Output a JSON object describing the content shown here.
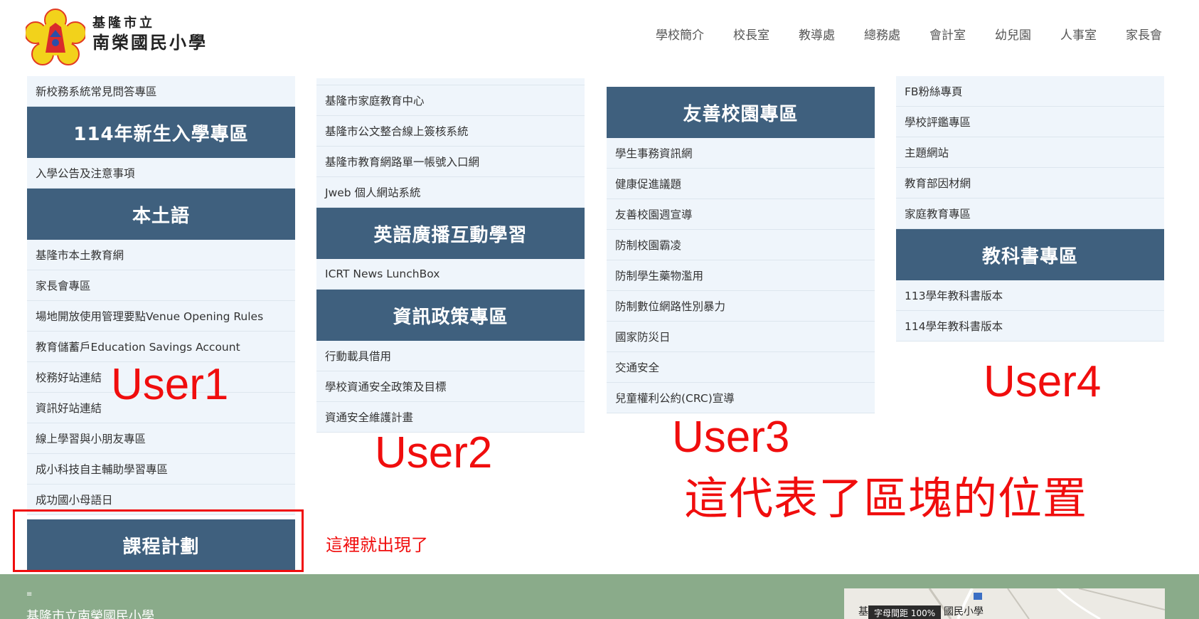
{
  "header": {
    "school_line1": "基隆市立",
    "school_line2": "南榮國民小學",
    "nav": [
      "學校簡介",
      "校長室",
      "教導處",
      "總務處",
      "會計室",
      "幼兒園",
      "人事室",
      "家長會"
    ]
  },
  "col1": {
    "top_link": "新校務系統常見問答專區",
    "sec1_title": "114年新生入學專區",
    "sec1_links": [
      "入學公告及注意事項"
    ],
    "sec2_title": "本土語",
    "sec2_links": [
      "基隆市本土教育網",
      "家長會專區",
      "場地開放使用管理要點Venue Opening Rules",
      "教育儲蓄戶Education Savings Account",
      "校務好站連結",
      "資訊好站連結",
      "線上學習與小朋友專區",
      "成小科技自主輔助學習專區",
      "成功國小母語日"
    ],
    "sec3_title": "課程計劃"
  },
  "col2": {
    "top_links": [
      "基隆市家庭教育中心",
      "基隆市公文整合線上簽核系統",
      "基隆市教育網路單一帳號入口網",
      "Jweb 個人網站系統"
    ],
    "sec1_title": "英語廣播互動學習",
    "sec1_links": [
      "ICRT News LunchBox"
    ],
    "sec2_title": "資訊政策專區",
    "sec2_links": [
      "行動載具借用",
      "學校資通安全政策及目標",
      "資通安全維護計畫"
    ]
  },
  "col3": {
    "sec1_title": "友善校園專區",
    "sec1_links": [
      "學生事務資訊網",
      "健康促進議題",
      "友善校園週宣導",
      "防制校園霸凌",
      "防制學生藥物濫用",
      "防制數位網路性別暴力",
      "國家防災日",
      "交通安全",
      "兒童權利公約(CRC)宣導"
    ]
  },
  "col4": {
    "top_links": [
      "FB粉絲專頁",
      "學校評鑑專區",
      "主題網站",
      "教育部因材網",
      "家庭教育專區"
    ],
    "sec1_title": "教科書專區",
    "sec1_links": [
      "113學年教科書版本",
      "114學年教科書版本"
    ]
  },
  "annotations": {
    "user1": "User1",
    "user2": "User2",
    "user3": "User3",
    "user4": "User4",
    "position_note": "這代表了區塊的位置",
    "appears_note": "這裡就出現了",
    "color": "#f00d0d"
  },
  "footer": {
    "icon_glyph": "≡",
    "school_name": "基隆市立南榮國民小學",
    "map_chip": "字母間距 100%",
    "map_label_left": "基",
    "map_label_right": "國民小學"
  },
  "colors": {
    "section_head_bg": "#3f607e",
    "link_bg": "#eff5fb",
    "footer_bg": "#8aab8a"
  }
}
